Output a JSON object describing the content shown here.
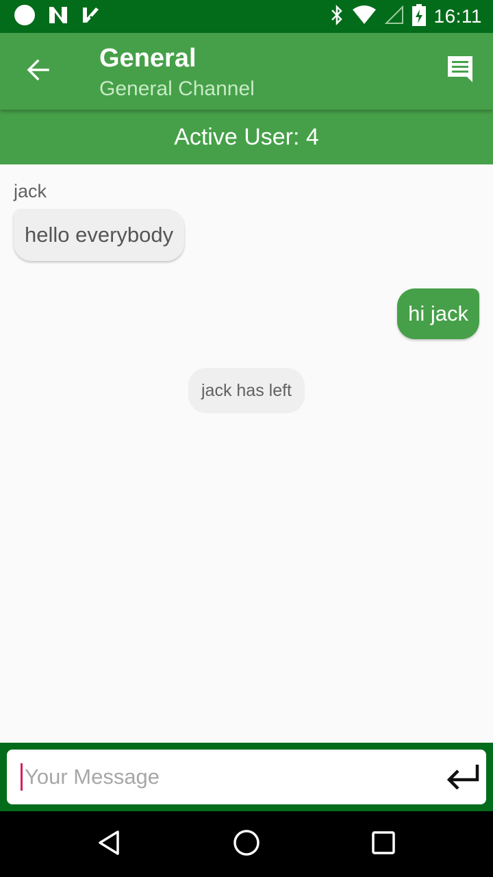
{
  "status_bar": {
    "time": "16:11",
    "left_icons": [
      "circle-notification-icon",
      "n-app-icon",
      "check-app-icon"
    ],
    "right_icons": [
      "bluetooth-icon",
      "wifi-icon",
      "cell-signal-icon",
      "battery-charging-icon"
    ]
  },
  "app_bar": {
    "title": "General",
    "subtitle": "General Channel",
    "back_icon": "arrow-back-icon",
    "action_icon": "chat-icon"
  },
  "active_banner": {
    "text": "Active User: 4"
  },
  "messages": [
    {
      "type": "incoming",
      "sender": "jack",
      "text": "hello everybody"
    },
    {
      "type": "outgoing",
      "text": "hi jack"
    },
    {
      "type": "system",
      "text": "jack has left"
    }
  ],
  "composer": {
    "placeholder": "Your Message",
    "value": "",
    "send_icon": "enter-return-icon"
  },
  "nav_bar": {
    "icons": [
      "back-triangle-icon",
      "home-circle-icon",
      "recents-square-icon"
    ]
  },
  "colors": {
    "primary": "#46a049",
    "primary_dark": "#026c1a",
    "accent": "#d81b60",
    "bubble_incoming": "#efefef"
  }
}
